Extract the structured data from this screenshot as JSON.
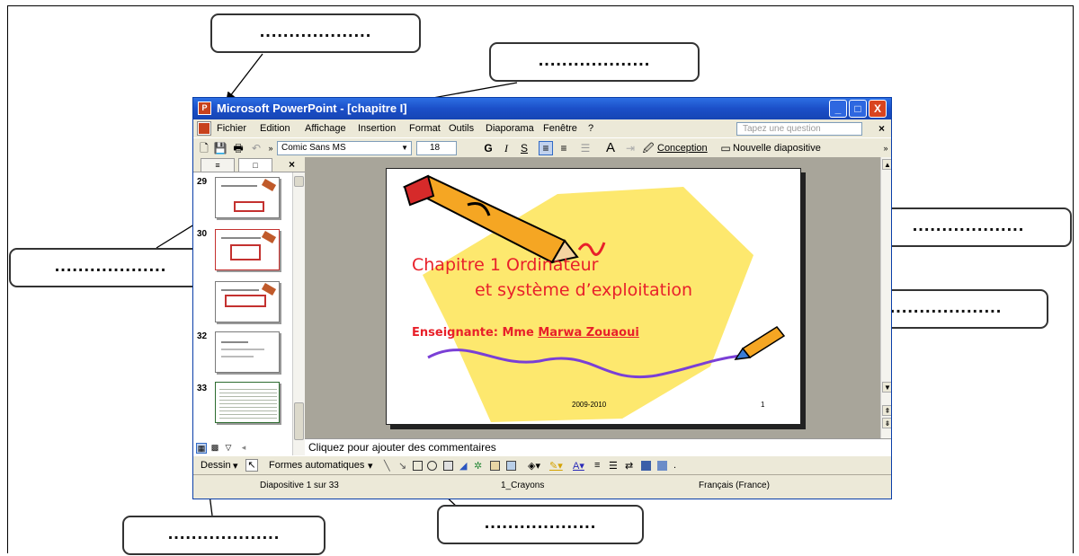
{
  "callouts": {
    "placeholder": "..................."
  },
  "window": {
    "title": "Microsoft PowerPoint - [chapitre I]",
    "controls": {
      "minimize": "_",
      "maximize": "□",
      "close": "X"
    }
  },
  "menubar": {
    "items": [
      "Fichier",
      "Edition",
      "Affichage",
      "Insertion",
      "Format",
      "Outils",
      "Diaporama",
      "Fenêtre",
      "?"
    ],
    "help_placeholder": "Tapez une question",
    "close": "×"
  },
  "toolbar": {
    "font": "Comic Sans MS",
    "size": "18",
    "bold": "G",
    "italic": "I",
    "underline": "S",
    "design_button": "Conception",
    "new_slide_button": "Nouvelle diapositive"
  },
  "outline_pane": {
    "tab_outline": "≡",
    "tab_slides": "□",
    "close": "×",
    "thumbnails": [
      {
        "number": "29"
      },
      {
        "number": "30"
      },
      {
        "number": ""
      },
      {
        "number": "32"
      },
      {
        "number": "33"
      }
    ]
  },
  "slide": {
    "title_line1": "Chapitre 1     Ordinateur",
    "title_line2": "et système d’exploitation",
    "teacher_label": "Enseignante: Mme ",
    "teacher_name": "Marwa Zouaoui",
    "year": "2009-2010",
    "number": "1"
  },
  "notes": {
    "placeholder": "Cliquez pour ajouter des commentaires"
  },
  "draw_toolbar": {
    "draw": "Dessin",
    "autoshapes": "Formes automatiques"
  },
  "statusbar": {
    "slide_position": "Diapositive 1 sur 33",
    "design": "1_Crayons",
    "language": "Français (France)"
  },
  "colors": {
    "titlebar": "#1b4fc8",
    "slide_text": "#e8202a",
    "slide_shape": "#fde86e"
  }
}
